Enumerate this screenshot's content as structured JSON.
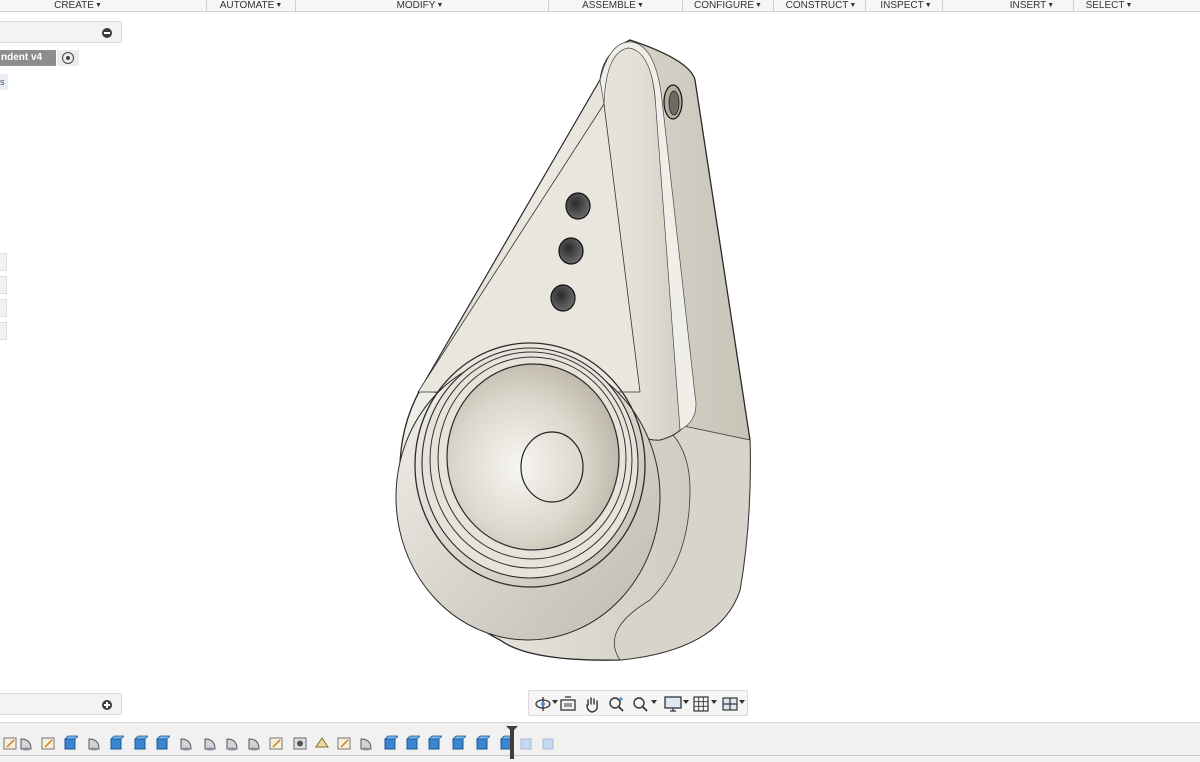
{
  "toolbar": {
    "menus": [
      {
        "label": "CREATE"
      },
      {
        "label": "AUTOMATE"
      },
      {
        "label": "MODIFY"
      },
      {
        "label": "ASSEMBLE"
      },
      {
        "label": "CONFIGURE"
      },
      {
        "label": "CONSTRUCT"
      },
      {
        "label": "INSPECT"
      },
      {
        "label": "INSERT"
      },
      {
        "label": "SELECT"
      }
    ]
  },
  "browser": {
    "document_name": "ndent v4",
    "tree_row_text": "s"
  },
  "navbar": {
    "tools": [
      {
        "icon": "orbit-icon"
      },
      {
        "icon": "look-at-icon"
      },
      {
        "icon": "pan-icon"
      },
      {
        "icon": "zoom-icon"
      },
      {
        "icon": "fit-icon"
      },
      {
        "icon": "display-settings-icon"
      },
      {
        "icon": "grid-settings-icon"
      },
      {
        "icon": "viewports-icon"
      }
    ]
  },
  "timeline": {
    "features": [
      "sketch",
      "revolve",
      "sketch",
      "extrude",
      "revolve",
      "extrude",
      "extrude",
      "extrude",
      "revolve",
      "revolve",
      "revolve",
      "revolve",
      "sketch",
      "hole",
      "construct",
      "sketch",
      "revolve",
      "extrude",
      "extrude",
      "extrude",
      "extrude",
      "extrude",
      "extrude",
      "suppressed",
      "suppressed"
    ]
  },
  "colors": {
    "model_body": "#e8e4dc",
    "model_shadow": "#b9b4aa",
    "timeline_feature": "#3b86d1"
  }
}
